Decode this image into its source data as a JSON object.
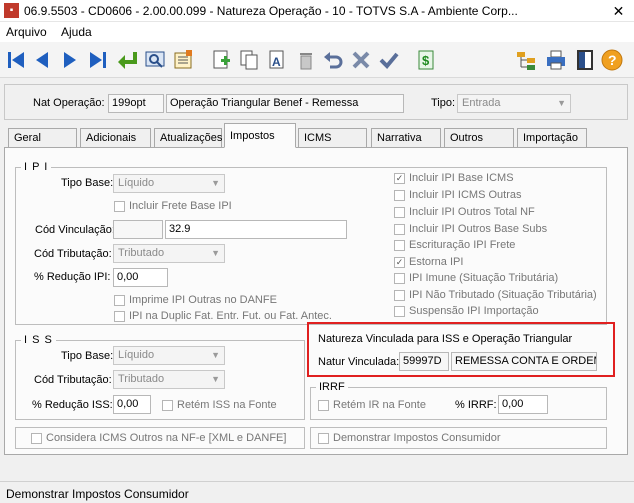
{
  "window": {
    "title": "06.9.5503 - CD0606 - 2.00.00.099 - Natureza Operação - 10 - TOTVS S.A - Ambiente Corp...",
    "close": "✕"
  },
  "menu": [
    "Arquivo",
    "Ajuda"
  ],
  "toolbar": {
    "icons": [
      "first-icon",
      "prev-icon",
      "next-icon",
      "last-icon",
      "exit-icon",
      "zoom-icon",
      "list-icon",
      "new-icon",
      "copy-icon",
      "edit-icon",
      "delete-icon",
      "undo-icon",
      "cancel-icon",
      "confirm-icon",
      "dollar-icon",
      "tree-icon",
      "print-icon",
      "door-icon",
      "help-icon"
    ],
    "accent": "#1f5fbf"
  },
  "header": {
    "nat_label": "Nat Operação:",
    "nat_code": "199opt",
    "nat_desc": "Operação Triangular Benef - Remessa",
    "tipo_label": "Tipo:",
    "tipo_value": "Entrada"
  },
  "tabs": [
    "Geral",
    "Adicionais",
    "Atualizações",
    "Impostos",
    "ICMS",
    "Narrativa",
    "Outros",
    "Importação"
  ],
  "active_tab": "Impostos",
  "ipi": {
    "title": "I P I",
    "tipo_base_label": "Tipo Base:",
    "tipo_base_value": "Líquido",
    "frete_label": "Incluir Frete Base IPI",
    "cod_vinc_label": "Cód Vinculação:",
    "cod_vinc_value": "32.9",
    "cod_trib_label": "Cód Tributação:",
    "cod_trib_value": "Tributado",
    "reducao_label": "% Redução IPI:",
    "reducao_value": "0,00",
    "imprime_label": "Imprime IPI Outras no DANFE",
    "duplic_label": "IPI na Duplic Fat. Entr. Fut. ou Fat. Antec.",
    "checks": [
      {
        "label": "Incluir IPI Base ICMS",
        "checked": true
      },
      {
        "label": "Incluir IPI ICMS Outras",
        "checked": false
      },
      {
        "label": "Incluir IPI Outros Total NF",
        "checked": false
      },
      {
        "label": "Incluir IPI Outros Base Subs",
        "checked": false
      },
      {
        "label": "Escrituração IPI Frete",
        "checked": false
      },
      {
        "label": "Estorna IPI",
        "checked": true
      },
      {
        "label": "IPI Imune (Situação Tributária)",
        "checked": false
      },
      {
        "label": "IPI Não Tributado (Situação Tributária)",
        "checked": false
      },
      {
        "label": "Suspensão IPI Importação",
        "checked": false
      }
    ]
  },
  "iss": {
    "title": "I S S",
    "tipo_base_label": "Tipo Base:",
    "tipo_base_value": "Líquido",
    "cod_trib_label": "Cód Tributação:",
    "cod_trib_value": "Tributado",
    "reducao_label": "% Redução ISS:",
    "reducao_value": "0,00",
    "retem_label": "Retém ISS na Fonte"
  },
  "natureza_vinculada": {
    "title": "Natureza Vinculada para ISS e Operação Triangular",
    "label": "Natur Vinculada:",
    "code": "59997D",
    "desc": "REMESSA CONTA E ORDEM",
    "highlight_color": "#e02020"
  },
  "irrf": {
    "title": "IRRF",
    "retem_label": "Retém IR na Fonte",
    "perc_label": "% IRRF:",
    "perc_value": "0,00"
  },
  "bottom": {
    "considera_label": "Considera ICMS Outros na NF-e [XML e DANFE]",
    "demonstrar_label": "Demonstrar Impostos Consumidor"
  },
  "status": "Demonstrar Impostos Consumidor"
}
